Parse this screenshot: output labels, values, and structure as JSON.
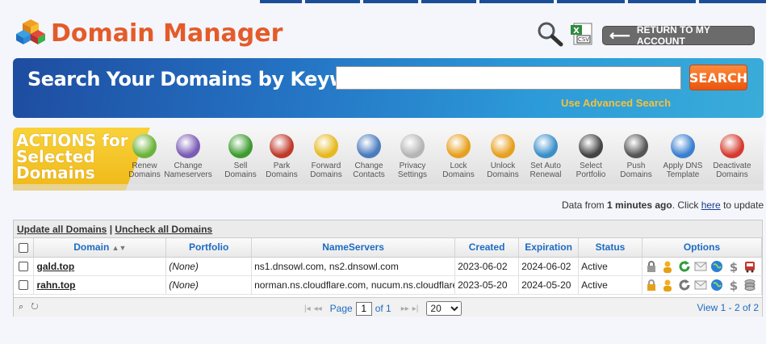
{
  "header": {
    "title": "Domain Manager",
    "return_label": "RETURN TO MY ACCOUNT"
  },
  "search": {
    "label": "Search Your Domains by Keyword",
    "value": "",
    "button_label": "SEARCH",
    "advanced_link": "Use Advanced Search"
  },
  "actions": {
    "title_line1": "ACTIONS for",
    "title_line2": "Selected",
    "title_line3": "Domains",
    "items": [
      {
        "label1": "Renew",
        "label2": "Domains",
        "icon": "renew-icon",
        "color": "#6bb33a"
      },
      {
        "label1": "Change",
        "label2": "Nameservers",
        "icon": "swap-arrows-icon",
        "color": "#7a5bb5"
      },
      {
        "label1": "Sell",
        "label2": "Domains",
        "icon": "dollar-icon",
        "color": "#3d9b2f"
      },
      {
        "label1": "Park",
        "label2": "Domains",
        "icon": "bus-icon",
        "color": "#c0392b"
      },
      {
        "label1": "Forward",
        "label2": "Domains",
        "icon": "arrow-right-icon",
        "color": "#e6b91e"
      },
      {
        "label1": "Change",
        "label2": "Contacts",
        "icon": "contacts-icon",
        "color": "#4a7bbd"
      },
      {
        "label1": "Privacy",
        "label2": "Settings",
        "icon": "privacy-icon",
        "color": "#b5b5b5"
      },
      {
        "label1": "Lock",
        "label2": "Domains",
        "icon": "lock-icon",
        "color": "#e6a01e"
      },
      {
        "label1": "Unlock",
        "label2": "Domains",
        "icon": "unlock-icon",
        "color": "#e6a01e"
      },
      {
        "label1": "Set Auto",
        "label2": "Renewal",
        "icon": "clock-icon",
        "color": "#3a8fc9"
      },
      {
        "label1": "Select",
        "label2": "Portfolio",
        "icon": "gauge-icon",
        "color": "#444444"
      },
      {
        "label1": "Push",
        "label2": "Domains",
        "icon": "computers-icon",
        "color": "#555555"
      },
      {
        "label1": "Apply DNS",
        "label2": "Template",
        "icon": "dns-template-icon",
        "color": "#3a7fd0"
      },
      {
        "label1": "Deactivate",
        "label2": "Domains",
        "icon": "deactivate-icon",
        "color": "#d63a2f"
      }
    ]
  },
  "status_line": {
    "prefix": "Data from ",
    "age": "1 minutes ago",
    "middle": ". Click ",
    "link": "here",
    "suffix": " to update"
  },
  "grid": {
    "update_all": "Update all Domains",
    "separator": " | ",
    "uncheck_all": "Uncheck all Domains",
    "columns": {
      "domain": "Domain",
      "portfolio": "Portfolio",
      "nameservers": "NameServers",
      "created": "Created",
      "expiration": "Expiration",
      "status": "Status",
      "options": "Options"
    },
    "rows": [
      {
        "domain": "gald.top",
        "portfolio": "(None)",
        "nameservers": "ns1.dnsowl.com, ns2.dnsowl.com",
        "created": "2023-06-02",
        "expiration": "2024-06-02",
        "status": "Active"
      },
      {
        "domain": "rahn.top",
        "portfolio": "(None)",
        "nameservers": "norman.ns.cloudflare.com, nucum.ns.cloudflare.com",
        "created": "2023-05-20",
        "expiration": "2024-05-20",
        "status": "Active"
      }
    ],
    "pager": {
      "page_label": "Page",
      "page_value": "1",
      "of_label": "of 1",
      "per_page": "20",
      "view_text": "View 1 - 2 of 2"
    }
  }
}
